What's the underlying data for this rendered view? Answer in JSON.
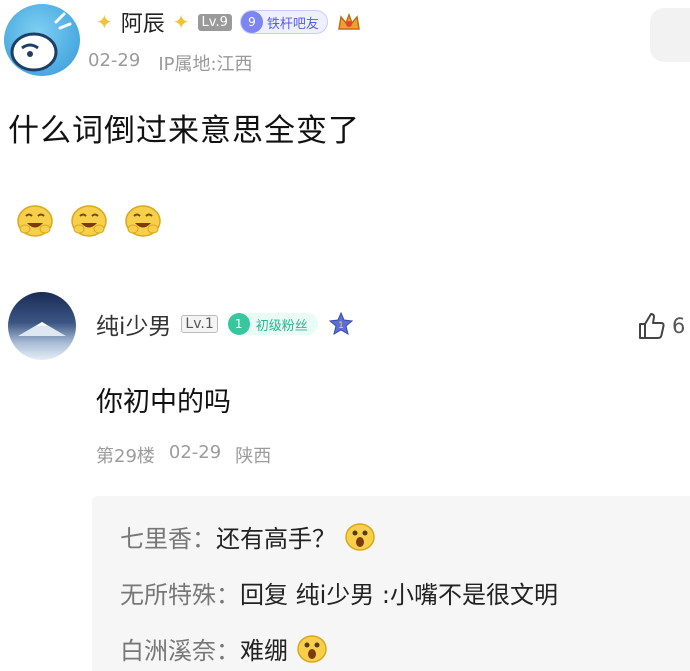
{
  "post": {
    "author": "阿辰",
    "level": "Lv.9",
    "fan_badge_number": "9",
    "fan_badge_label": "铁杆吧友",
    "date": "02-29",
    "ip_location": "IP属地:江西",
    "title": "什么词倒过来意思全变了",
    "emojis": [
      "grinning-face-icon",
      "grinning-face-icon",
      "grinning-face-icon"
    ]
  },
  "reply": {
    "author": "纯i少男",
    "level": "Lv.1",
    "fan_badge_number": "1",
    "fan_badge_label": "初级粉丝",
    "text": "你初中的吗",
    "floor": "第29楼",
    "date": "02-29",
    "location": "陕西",
    "like_count": "6"
  },
  "sub_replies": [
    {
      "user": "七里香：",
      "text": "还有高手？",
      "emoji": "surprised-face-icon"
    },
    {
      "user": "无所特殊：",
      "text": "回复 纯i少男 :小嘴不是很文明",
      "emoji": ""
    },
    {
      "user": "白洲溪奈：",
      "text": "难绷",
      "emoji": "surprised-face-icon"
    }
  ],
  "colors": {
    "fan_badge": "#7d86f0",
    "rookie_badge": "#37c79e",
    "meta_text": "#9a9a9a",
    "sub_reply_bg": "#f6f6f6"
  }
}
